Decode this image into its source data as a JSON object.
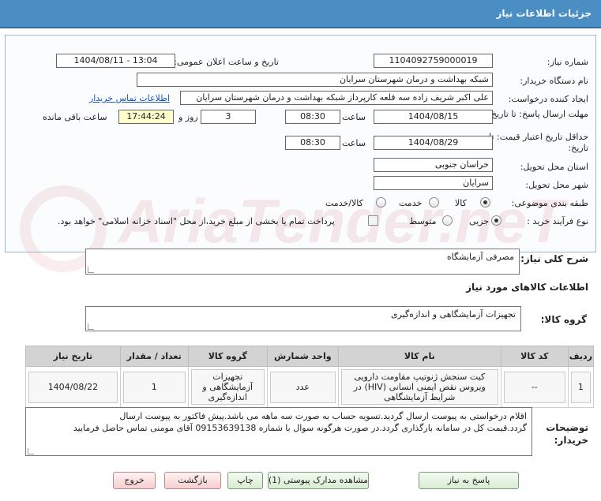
{
  "header": {
    "title": "جزئیات اطلاعات نیاز"
  },
  "form": {
    "need_number_label": "شماره نیاز:",
    "need_number": "1104092759000019",
    "announce_label": "تاریخ و ساعت اعلان عمومی:",
    "announce_value": "1404/08/11 - 13:04",
    "buyer_org_label": "نام دستگاه خریدار:",
    "buyer_org": "شبکه بهداشت و درمان شهرستان سرایان",
    "creator_label": "ایجاد کننده درخواست:",
    "creator": "علی اکبر شریف زاده سه قلعه کارپرداز شبکه بهداشت و درمان شهرستان سرایان",
    "contact_link": "اطلاعات تماس خریدار",
    "reply_deadline_label": "مهلت ارسال پاسخ: تا تاریخ:",
    "reply_date": "1404/08/15",
    "time_label": "ساعت",
    "reply_time": "08:30",
    "days_value": "3",
    "days_label": "روز و",
    "remaining_time": "17:44:24",
    "remaining_label": "ساعت باقی مانده",
    "validity_label": "حداقل تاریخ اعتبار قیمت: تا تاریخ:",
    "validity_date": "1404/08/29",
    "validity_time": "08:30",
    "province_label": "استان محل تحویل:",
    "province": "خراسان جنوبی",
    "city_label": "شهر محل تحویل:",
    "city": "سرایان",
    "category_label": "طبقه بندی موضوعی:",
    "category_options": [
      "کالا",
      "خدمت",
      "کالا/خدمت"
    ],
    "category_selected": "کالا",
    "process_label": "نوع فرآیند خرید :",
    "process_options": [
      "جزیی",
      "متوسط"
    ],
    "process_selected": "جزیی",
    "payment_note": "پرداخت تمام یا بخشی از مبلغ خرید،از محل \"اسناد خزانه اسلامی\" خواهد بود."
  },
  "watermark": "AriaTender.neT",
  "general_desc": {
    "label": "شرح کلی نیاز:",
    "value": "مصرفی آزمایشگاه"
  },
  "goods_info_title": "اطلاعات کالاهای مورد نیاز",
  "goods_group": {
    "label": "گروه کالا:",
    "value": "تجهیزات آزمایشگاهی و اندازه‌گیری"
  },
  "table": {
    "headers": [
      "ردیف",
      "کد کالا",
      "نام کالا",
      "واحد شمارش",
      "گروه کالا",
      "تعداد / مقدار",
      "تاریخ نیاز"
    ],
    "rows": [
      {
        "row": "1",
        "code": "--",
        "name": "کیت سنجش ژنوتیپ مقاومت دارویی ویروس نقص ایمنی انسانی (HIV) در شرایط آزمایشگاهی",
        "unit": "عدد",
        "group": "تجهیزات آزمایشگاهی و اندازه‌گیری",
        "qty": "1",
        "date": "1404/08/22"
      }
    ]
  },
  "buyer_notes": {
    "label": "توضیحات خریدار:",
    "line1": "اقلام درخواستی به پیوست ارسال گردید.تسویه حساب به صورت سه ماهه می باشد.پیش فاکتور به پیوست ارسال",
    "line2": "گردد.قیمت کل در سامانه بارگذاری گردد.در صورت هرگونه سوال با شماره 09153639138 آقای مومنی تماس حاصل فرمایید"
  },
  "buttons": {
    "reply": "پاسخ به نیاز",
    "view_docs": "مشاهده مدارک پیوستی (1)",
    "print": "چاپ",
    "back": "بازگشت",
    "exit": "خروج"
  }
}
